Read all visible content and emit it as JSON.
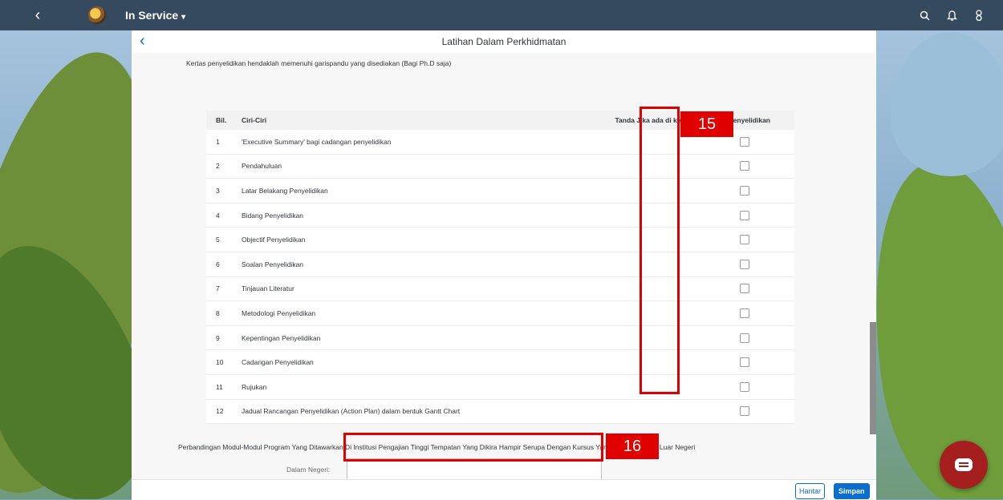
{
  "shell": {
    "app_title": "In Service",
    "caret": "▾",
    "back_glyph": "‹",
    "icons": [
      "search-icon",
      "bell-icon",
      "user-icon"
    ]
  },
  "page": {
    "title": "Latihan Dalam Perkhidmatan",
    "back_glyph": "‹",
    "intro": "Kertas penyelidikan hendaklah memenuhi garispandu yang disediakan (Bagi Ph.D saja)"
  },
  "table": {
    "headers": [
      "Bil.",
      "Ciri-Ciri",
      "Tanda Jika ada di kertas cadangan penyelidikan"
    ],
    "rows": [
      {
        "no": "1",
        "text": "'Executive Summary' bagi cadangan penyelidikan"
      },
      {
        "no": "2",
        "text": "Pendahuluan"
      },
      {
        "no": "3",
        "text": "Latar Belakang Penyelidikan"
      },
      {
        "no": "4",
        "text": "Bidang Penyelidikan"
      },
      {
        "no": "5",
        "text": "Objectif Penyelidikan"
      },
      {
        "no": "6",
        "text": "Soalan Penyelidikan"
      },
      {
        "no": "7",
        "text": "Tinjauan Literatur"
      },
      {
        "no": "8",
        "text": "Metodologi Penyelidikan"
      },
      {
        "no": "9",
        "text": "Kepentingan Penyelidikan"
      },
      {
        "no": "10",
        "text": "Cadangan Penyelidikan"
      },
      {
        "no": "11",
        "text": "Rujukan"
      },
      {
        "no": "12",
        "text": "Jadual Rancangan Penyelidikan (Action Plan) dalam bentuk Gantt Chart"
      }
    ]
  },
  "comparison": {
    "text": "Perbandingan Modul-Modul Program Yang Ditawarkan Di Institusi Pengajian Tinggi Tempatan Yang Dikira Hampir Serupa Dengan Kursus Yang Dipohonkan Di Luar Negeri",
    "dalam_negeri_label": "Dalam Negeri:",
    "dalam_negeri_value": ""
  },
  "footer": {
    "hantar_label": "Hantar",
    "simpan_label": "Simpan"
  },
  "annotations": {
    "box15_label": "15",
    "box16_label": "16",
    "color": "#e00000"
  }
}
